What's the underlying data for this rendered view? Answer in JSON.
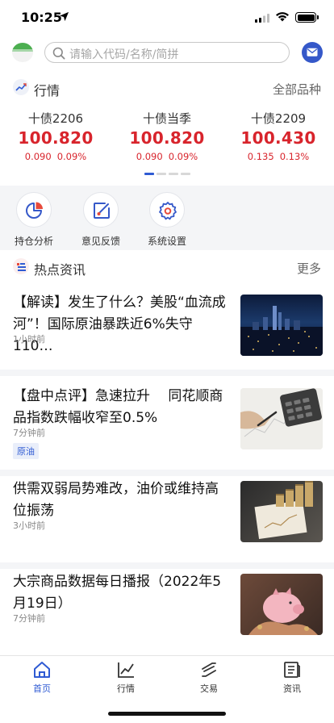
{
  "status_bar": {
    "time": "10:25"
  },
  "search": {
    "placeholder": "请输入代码/名称/简拼"
  },
  "market": {
    "title": "行情",
    "more_label": "全部品种",
    "quotes": [
      {
        "name": "十债2206",
        "price": "100.820",
        "change": "0.090",
        "change_pct": "0.09%"
      },
      {
        "name": "十债当季",
        "price": "100.820",
        "change": "0.090",
        "change_pct": "0.09%"
      },
      {
        "name": "十债2209",
        "price": "100.430",
        "change": "0.135",
        "change_pct": "0.13%"
      }
    ],
    "page_indicator": {
      "pages": 4,
      "active": 0
    }
  },
  "quick_actions": [
    {
      "label": "持仓分析",
      "icon": "pie-chart-icon"
    },
    {
      "label": "意见反馈",
      "icon": "edit-feedback-icon"
    },
    {
      "label": "系统设置",
      "icon": "settings-gear-icon"
    }
  ],
  "news": {
    "title": "热点资讯",
    "more_label": "更多",
    "items": [
      {
        "title": "【解读】发生了什么？美股“血流成河”！国际原油暴跌近6%失守110…",
        "time": "1小时前",
        "tag": "",
        "thumb": "city-night-photo"
      },
      {
        "title": "【盘中点评】急速拉升　 同花顺商品指数跌幅收窄至0.5%",
        "time": "7分钟前",
        "tag": "原油",
        "thumb": "calculator-chart-photo"
      },
      {
        "title": "供需双弱局势难改，油价或维持高位振荡",
        "time": "3小时前",
        "tag": "",
        "thumb": "coin-stacks-photo"
      },
      {
        "title": "大宗商品数据每日播报（2022年5月19日）",
        "time": "7分钟前",
        "tag": "",
        "thumb": "piggy-bank-photo"
      }
    ]
  },
  "tabbar": {
    "tabs": [
      {
        "label": "首页",
        "icon": "home-icon",
        "active": true
      },
      {
        "label": "行情",
        "icon": "line-chart-icon",
        "active": false
      },
      {
        "label": "交易",
        "icon": "trade-icon",
        "active": false
      },
      {
        "label": "资讯",
        "icon": "news-document-icon",
        "active": false
      }
    ]
  },
  "colors": {
    "accent": "#2f5bd3",
    "up_red": "#d8242c",
    "section_bg": "#f4f5f7"
  }
}
